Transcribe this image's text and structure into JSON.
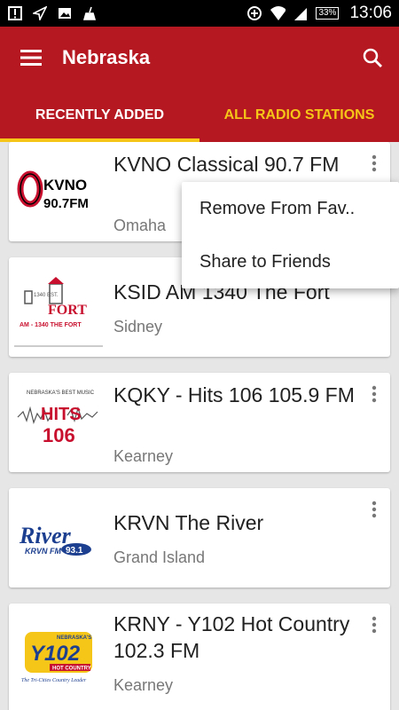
{
  "status_bar": {
    "time": "13:06",
    "battery": "33%",
    "icons": [
      "alert-icon",
      "send-icon",
      "image-icon",
      "broom-icon",
      "data-saver-icon",
      "wifi-icon",
      "signal-icon",
      "battery-icon"
    ]
  },
  "app_bar": {
    "title": "Nebraska",
    "menu_icon": "hamburger-menu-icon",
    "search_icon": "search-icon",
    "color": "#b51821"
  },
  "tabs": [
    {
      "label": "RECENTLY ADDED",
      "active": true
    },
    {
      "label": "ALL RADIO STATIONS",
      "active": false
    }
  ],
  "stations": [
    {
      "name": "KVNO Classical 90.7 FM",
      "city": "Omaha",
      "logo": {
        "primary": "KVNO",
        "secondary": "90.7FM"
      }
    },
    {
      "name": "KSID AM 1340 The Fort",
      "city": "Sidney",
      "logo": {
        "primary": "FORT",
        "secondary": "AM - 1340 THE FORT",
        "top": "1340  EST."
      }
    },
    {
      "name": "KQKY - Hits 106 105.9 FM",
      "city": "Kearney",
      "logo": {
        "primary": "HITS",
        "secondary": "106",
        "top": "NEBRASKA'S BEST MUSIC"
      }
    },
    {
      "name": "KRVN The River",
      "city": "Grand Island",
      "logo": {
        "primary": "River",
        "secondary": "KRVN FM",
        "badge": "93.1"
      }
    },
    {
      "name": "KRNY - Y102 Hot Country 102.3 FM",
      "city": "Kearney",
      "logo": {
        "primary": "Y102",
        "secondary": "HOT COUNTRY",
        "top": "NEBRASKA'S",
        "tagline": "The Tri-Cities Country Leader"
      }
    }
  ],
  "popup_menu": {
    "items": [
      "Remove From Fav..",
      "Share to Friends"
    ]
  },
  "colors": {
    "accent": "#f5c518",
    "background": "#e6e6e6"
  }
}
